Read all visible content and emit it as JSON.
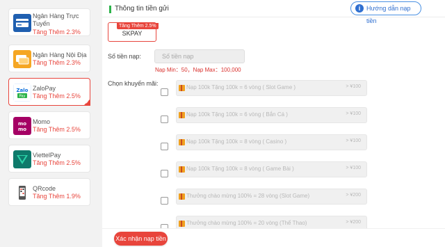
{
  "colors": {
    "accent": "#e8453c",
    "link": "#2f6fd0",
    "header_bar": "#2db34a"
  },
  "sidebar": {
    "items": [
      {
        "icon": "bank-card-icon",
        "name": "Ngân Hàng Trực Tuyến",
        "bonus": "Tăng Thêm 2.3%",
        "selected": false
      },
      {
        "icon": "domestic-bank-icon",
        "name": "Ngân Hàng Nội Địa",
        "bonus": "Tăng Thêm 2.3%",
        "selected": false
      },
      {
        "icon": "zalopay-icon",
        "name": "ZaloPay",
        "bonus": "Tăng Thêm 2.5%",
        "selected": true
      },
      {
        "icon": "momo-icon",
        "name": "Momo",
        "bonus": "Tăng Thêm 2.5%",
        "selected": false
      },
      {
        "icon": "viettelpay-icon",
        "name": "ViettelPay",
        "bonus": "Tăng Thêm 2.5%",
        "selected": false
      },
      {
        "icon": "qrcode-icon",
        "name": "QRcode",
        "bonus": "Tăng Thêm 1.9%",
        "selected": false
      }
    ]
  },
  "main": {
    "title": "Thông tin tiền gửi",
    "guide_label": "Hướng dẫn nạp tiền",
    "channel": {
      "tag": "Tăng Thêm 2.5%",
      "label": "SKPAY"
    },
    "amount": {
      "label": "Số tiền nạp:",
      "placeholder": "Số tiền nạp",
      "limits": "Nạp Min：50，Nạp Max：100,000"
    },
    "promo": {
      "label": "Chọn khuyến mãi:",
      "items": [
        {
          "text": "Nạp 100k Tặng 100k = 6 vòng ( Slot Game )",
          "value": "> ¥100"
        },
        {
          "text": "Nạp 100k Tặng 100k = 6 vòng ( Bắn Cá )",
          "value": "> ¥100"
        },
        {
          "text": "Nạp 100k Tặng 100k = 8 vòng ( Casino )",
          "value": "> ¥100"
        },
        {
          "text": "Nạp 100k Tặng 100k = 8 vòng ( Game Bài )",
          "value": "> ¥100"
        },
        {
          "text": "Thưởng chào mừng 100% = 28 vòng (Slot Game)",
          "value": "> ¥200"
        },
        {
          "text": "Thưởng chào mừng 100% = 20 vòng (Thể Thao)",
          "value": "> ¥200"
        }
      ]
    },
    "submit_label": "Xác nhận nạp tiền"
  }
}
